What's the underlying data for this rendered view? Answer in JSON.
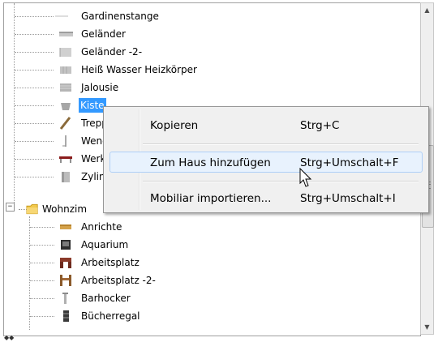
{
  "tree": {
    "items_above": [
      {
        "label": "Gardinenstange",
        "icon": "curtain-rod-icon"
      },
      {
        "label": "Geländer",
        "icon": "railing-icon"
      },
      {
        "label": "Geländer -2-",
        "icon": "railing-icon"
      },
      {
        "label": "Heiß Wasser Heizkörper",
        "icon": "radiator-icon"
      },
      {
        "label": "Jalousie",
        "icon": "blind-icon"
      },
      {
        "label": "Kiste",
        "icon": "crate-icon",
        "selected": true
      },
      {
        "label": "Trepp",
        "icon": "stairs-icon"
      },
      {
        "label": "Wend",
        "icon": "spiral-stairs-icon"
      },
      {
        "label": "Werk",
        "icon": "workbench-icon"
      },
      {
        "label": "Zylind",
        "icon": "cylinder-icon"
      }
    ],
    "folder": {
      "label": "Wohnzim",
      "icon": "folder-icon",
      "expander": "−"
    },
    "items_below": [
      {
        "label": "Anrichte",
        "icon": "sideboard-icon"
      },
      {
        "label": "Aquarium",
        "icon": "aquarium-icon"
      },
      {
        "label": "Arbeitsplatz",
        "icon": "desk-icon"
      },
      {
        "label": "Arbeitsplatz -2-",
        "icon": "desk-icon"
      },
      {
        "label": "Barhocker",
        "icon": "bar-stool-icon"
      },
      {
        "label": "Bücherregal",
        "icon": "bookshelf-icon"
      }
    ]
  },
  "context_menu": {
    "items": [
      {
        "label": "Kopieren",
        "shortcut": "Strg+C"
      },
      {
        "label": "Zum Haus hinzufügen",
        "shortcut": "Strg+Umschalt+F",
        "hover": true
      },
      {
        "label": "Mobiliar importieren...",
        "shortcut": "Strg+Umschalt+I"
      }
    ]
  },
  "scrollbar": {
    "up_arrow": "▲",
    "down_arrow": "▼"
  },
  "resize_grip": "◆◆"
}
